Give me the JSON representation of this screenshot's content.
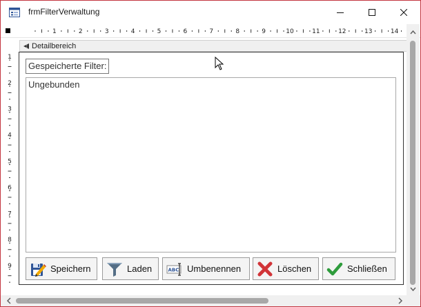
{
  "window": {
    "title": "frmFilterVerwaltung"
  },
  "section": {
    "label": "Detailbereich"
  },
  "form": {
    "filter_label": "Gespeicherte Filter:",
    "filter_list_items": [
      "Ungebunden"
    ]
  },
  "buttons": {
    "save": "Speichern",
    "load": "Laden",
    "rename": "Umbenennen",
    "delete": "Löschen",
    "close": "Schließen"
  },
  "ruler": {
    "h_labels": [
      "1",
      "2",
      "3",
      "4",
      "5",
      "6",
      "7",
      "8",
      "9",
      "10",
      "11",
      "12",
      "13",
      "14"
    ],
    "v_labels": [
      "1",
      "2",
      "3",
      "4",
      "5",
      "6",
      "7",
      "8",
      "9"
    ]
  },
  "colors": {
    "window_border": "#c3343f",
    "icon_blue": "#2f5597",
    "delete_red": "#d13438",
    "check_green": "#2e9c3c"
  },
  "icons": {
    "app": "form-icon",
    "save": "floppy-pencil-icon",
    "load": "funnel-icon",
    "rename": "abc-rename-icon",
    "delete": "red-x-icon",
    "close": "green-check-icon"
  }
}
